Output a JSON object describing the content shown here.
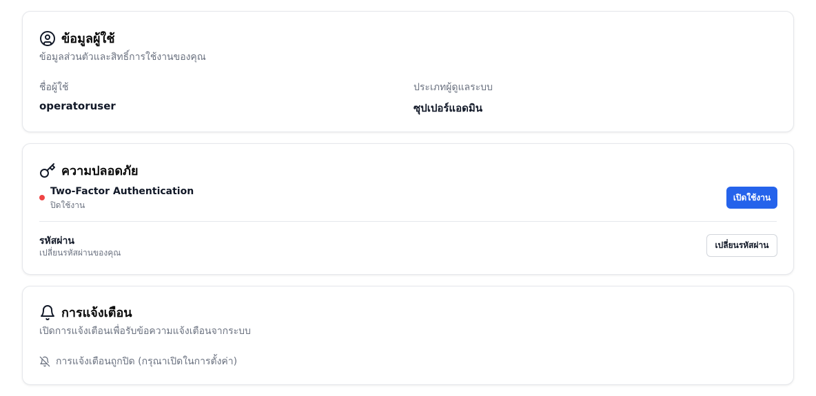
{
  "colors": {
    "primary": "#2563eb",
    "status_off": "#ef4444",
    "muted_text": "#6b7280"
  },
  "profile": {
    "icon": "user-circle-icon",
    "title": "ข้อมูลผู้ใช้",
    "description": "ข้อมูลส่วนตัวและสิทธิ์การใช้งานของคุณ",
    "username_label": "ชื่อผู้ใช้",
    "username_value": "operatoruser",
    "admin_type_label": "ประเภทผู้ดูแลระบบ",
    "admin_type_value": "ซุปเปอร์แอดมิน"
  },
  "security": {
    "icon": "key-icon",
    "title": "ความปลอดภัย",
    "two_factor": {
      "title": "Two-Factor Authentication",
      "status": "ปิดใช้งาน",
      "button_label": "เปิดใช้งาน"
    },
    "password": {
      "title": "รหัสผ่าน",
      "description": "เปลี่ยนรหัสผ่านของคุณ",
      "button_label": "เปลี่ยนรหัสผ่าน"
    }
  },
  "notifications": {
    "icon": "bell-icon",
    "title": "การแจ้งเตือน",
    "description": "เปิดการแจ้งเตือนเพื่อรับข้อความแจ้งเตือนจากระบบ",
    "status_icon": "bell-off-icon",
    "status_text": "การแจ้งเตือนถูกปิด (กรุณาเปิดในการตั้งค่า)"
  }
}
